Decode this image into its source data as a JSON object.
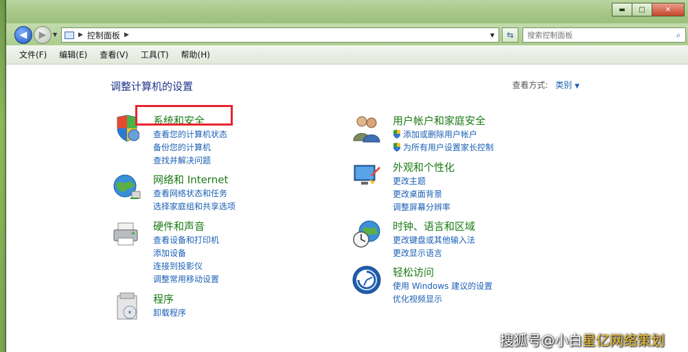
{
  "window": {
    "controls": {
      "minimize": "▬",
      "maximize": "□",
      "close": "✕"
    }
  },
  "address": {
    "breadcrumb": "控制面板",
    "search_placeholder": "搜索控制面板"
  },
  "menu": [
    "文件(F)",
    "编辑(E)",
    "查看(V)",
    "工具(T)",
    "帮助(H)"
  ],
  "main": {
    "title": "调整计算机的设置",
    "view_by_label": "查看方式:",
    "view_by_value": "类别"
  },
  "categories": [
    {
      "id": "system-security",
      "title": "系统和安全",
      "links": [
        "查看您的计算机状态",
        "备份您的计算机",
        "查找并解决问题"
      ]
    },
    {
      "id": "network",
      "title": "网络和 Internet",
      "links": [
        "查看网络状态和任务",
        "选择家庭组和共享选项"
      ]
    },
    {
      "id": "hardware",
      "title": "硬件和声音",
      "links": [
        "查看设备和打印机",
        "添加设备",
        "连接到投影仪",
        "调整常用移动设置"
      ]
    },
    {
      "id": "programs",
      "title": "程序",
      "links": [
        "卸载程序"
      ]
    },
    {
      "id": "user-accounts",
      "title": "用户帐户和家庭安全",
      "links": [
        "添加或删除用户帐户",
        "为所有用户设置家长控制"
      ]
    },
    {
      "id": "appearance",
      "title": "外观和个性化",
      "links": [
        "更改主题",
        "更改桌面背景",
        "调整屏幕分辨率"
      ]
    },
    {
      "id": "clock-region",
      "title": "时钟、语言和区域",
      "links": [
        "更改键盘或其他输入法",
        "更改显示语言"
      ]
    },
    {
      "id": "ease-access",
      "title": "轻松访问",
      "links": [
        "使用 Windows 建议的设置",
        "优化视频显示"
      ]
    }
  ],
  "watermark": {
    "text": "搜狐号@小白",
    "accent": "星亿网络策划"
  },
  "colors": {
    "title_green": "#1a7a14",
    "link_blue": "#1a5fb4",
    "highlight_red": "#e8232b"
  }
}
